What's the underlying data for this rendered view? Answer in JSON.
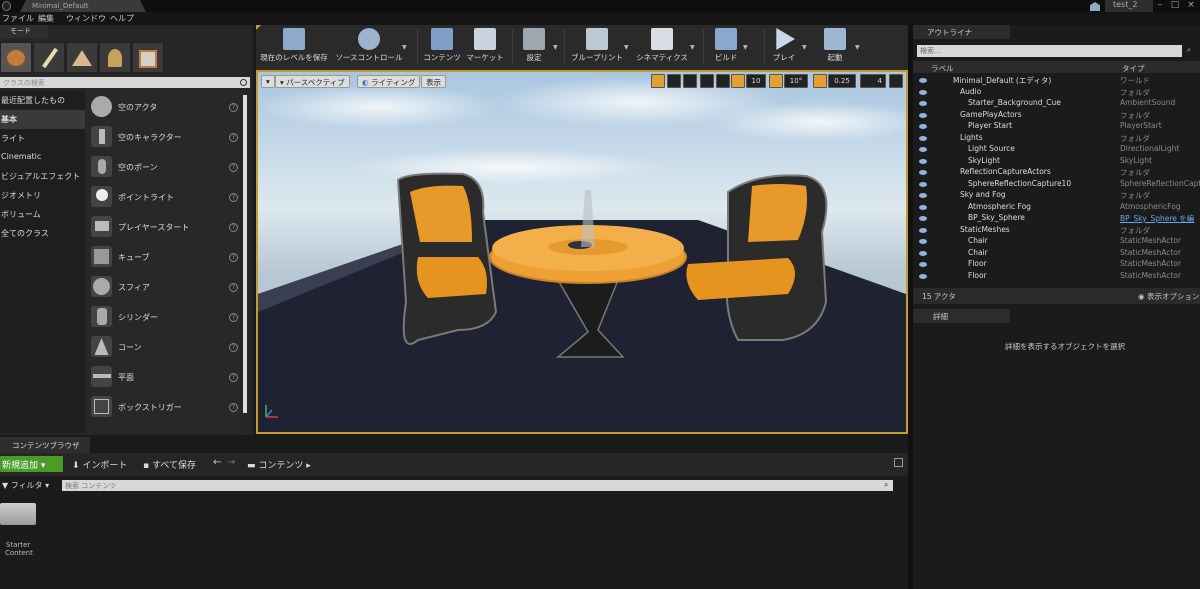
{
  "title_bar": {
    "tab_title": "Minimal_Default",
    "project": "test_2"
  },
  "menu": [
    "ファイル",
    "編集",
    "ウィンドウ",
    "ヘルプ"
  ],
  "modes": {
    "tab": "モード",
    "search_placeholder": "クラスの検索",
    "categories": [
      "最近配置したもの",
      "基本",
      "ライト",
      "Cinematic",
      "ビジュアルエフェクト",
      "ジオメトリ",
      "ボリューム",
      "全てのクラス"
    ],
    "items": [
      "空のアクタ",
      "空のキャラクター",
      "空のポーン",
      "ポイントライト",
      "プレイヤースタート",
      "キューブ",
      "スフィア",
      "シリンダー",
      "コーン",
      "平面",
      "ボックストリガー"
    ]
  },
  "toolbar": [
    "現在のレベルを保存",
    "ソースコントロール",
    "コンテンツ",
    "マーケット",
    "設定",
    "ブループリント",
    "シネマティクス",
    "ビルド",
    "プレイ",
    "起動"
  ],
  "viewport": {
    "perspective": "パースペクティブ",
    "lighting": "ライティング",
    "show": "表示",
    "grid": "10",
    "rotation": "10°",
    "scale": "0.25",
    "camera_speed": "4"
  },
  "outliner": {
    "tab": "アウトライナ",
    "search_placeholder": "検索...",
    "col_label": "ラベル",
    "col_type": "タイプ",
    "rows": [
      {
        "label": "Minimal_Default (エディタ)",
        "type": "ワールド"
      },
      {
        "label": "Audio",
        "type": "フォルダ"
      },
      {
        "label": "Starter_Background_Cue",
        "type": "AmbientSound"
      },
      {
        "label": "GamePlayActors",
        "type": "フォルダ"
      },
      {
        "label": "Player Start",
        "type": "PlayerStart"
      },
      {
        "label": "Lights",
        "type": "フォルダ"
      },
      {
        "label": "Light Source",
        "type": "DirectionalLight"
      },
      {
        "label": "SkyLight",
        "type": "SkyLight"
      },
      {
        "label": "ReflectionCaptureActors",
        "type": "フォルダ"
      },
      {
        "label": "SphereReflectionCapture10",
        "type": "SphereReflectionCaptu"
      },
      {
        "label": "Sky and Fog",
        "type": "フォルダ"
      },
      {
        "label": "Atmospheric Fog",
        "type": "AtmosphericFog"
      },
      {
        "label": "BP_Sky_Sphere",
        "type": "BP_Sky_Sphere を編"
      },
      {
        "label": "StaticMeshes",
        "type": "フォルダ"
      },
      {
        "label": "Chair",
        "type": "StaticMeshActor"
      },
      {
        "label": "Chair",
        "type": "StaticMeshActor"
      },
      {
        "label": "Floor",
        "type": "StaticMeshActor"
      },
      {
        "label": "Floor",
        "type": "StaticMeshActor"
      }
    ],
    "actor_count": "15 アクタ",
    "view_options": "表示オプション"
  },
  "details": {
    "tab": "詳細",
    "empty_msg": "詳細を表示するオブジェクトを選択"
  },
  "content_browser": {
    "tab": "コンテンツブラウザ",
    "add_new": "新規追加",
    "import": "インポート",
    "save_all": "すべて保存",
    "path": "コンテンツ",
    "filters": "フィルタ",
    "search_placeholder": "検索 コンテンツ",
    "folder_line1": "Starter",
    "folder_line2": "Content"
  },
  "colors": {
    "accent": "#c69b29",
    "add_green": "#4a9b2a",
    "link": "#6aa7e8"
  }
}
